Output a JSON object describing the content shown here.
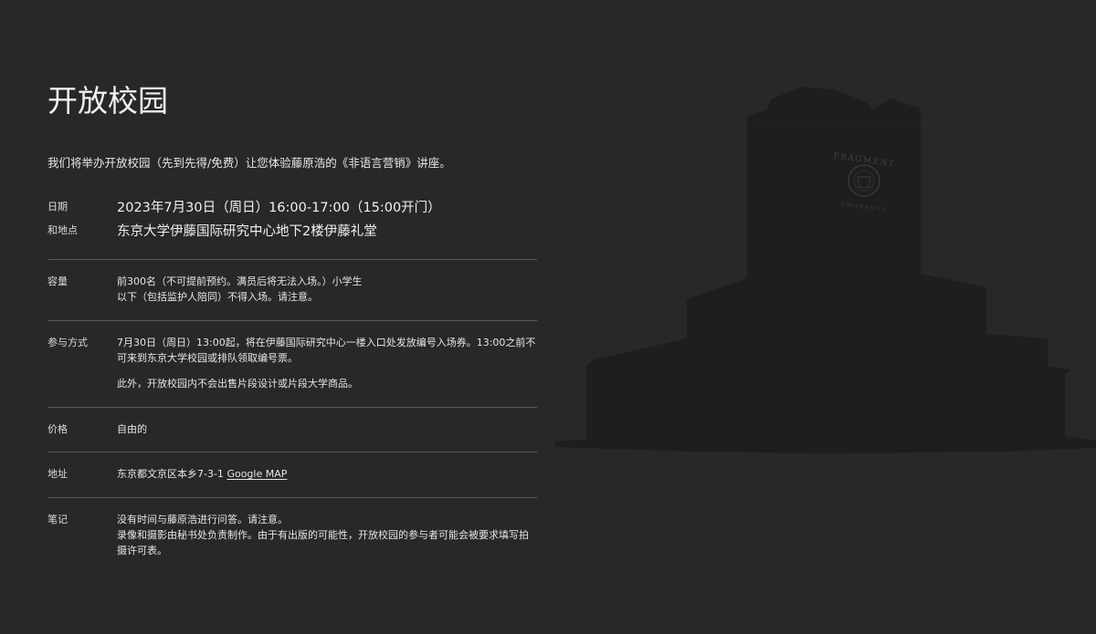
{
  "page": {
    "title": "开放校园",
    "intro": "我们将举办开放校园（先到先得/免费）让您体验藤原浩的《非语言营销》讲座。"
  },
  "schedule": {
    "date_label": "日期",
    "date_value": "2023年7月30日（周日）16:00-17:00（15:00开门）",
    "place_label": "和地点",
    "place_value": "东京大学伊藤国际研究中心地下2楼伊藤礼堂"
  },
  "details": {
    "capacity": {
      "label": "容量",
      "text": "前300名（不可提前预约。满员后将无法入场。）小学生以下（包括监护人陪同）不得入场。请注意。"
    },
    "method": {
      "label": "参与方式",
      "text1": "7月30日（周日）13:00起，将在伊藤国际研究中心一楼入口处发放编号入场券。13:00之前不可来到东京大学校园或排队领取编号票。",
      "text2": "此外，开放校园内不会出售片段设计或片段大学商品。"
    },
    "price": {
      "label": "价格",
      "text": "自由的"
    },
    "address": {
      "label": "地址",
      "text": "东京都文京区本乡7-3-1",
      "link": "Google MAP"
    },
    "notes": {
      "label": "笔记",
      "text1": "没有时间与藤原浩进行问答。请注意。",
      "text2": "录像和摄影由秘书处负责制作。由于有出版的可能性，开放校园的参与者可能会被要求填写拍摄许可表。"
    }
  },
  "building": {
    "sign_top": "FRAGMENT",
    "sign_bottom": "UNIVERSITY"
  },
  "colors": {
    "background": "#282828",
    "building": "#1d1d1d",
    "divider": "#5a5a5a",
    "text": "#e6e6e6"
  }
}
